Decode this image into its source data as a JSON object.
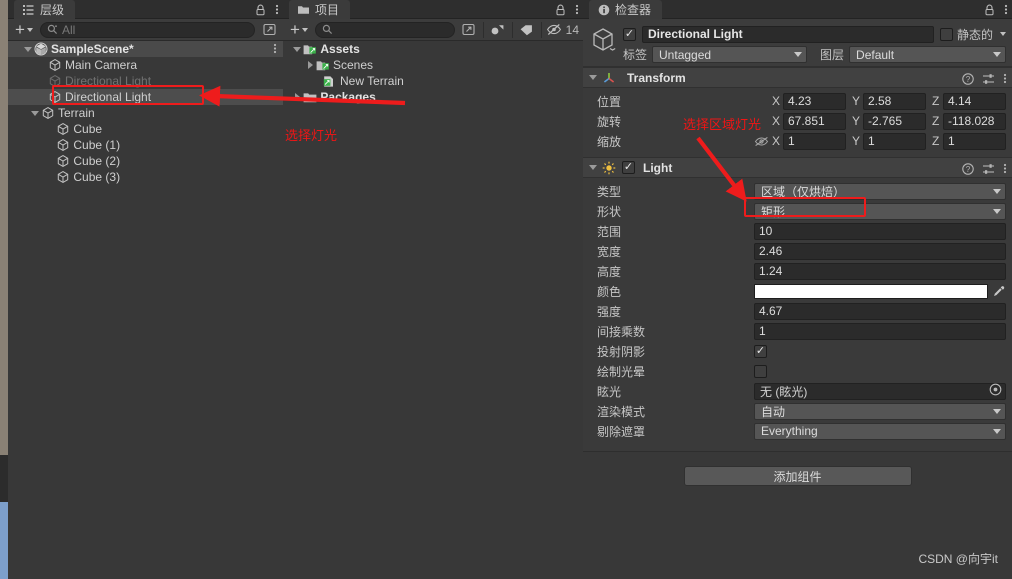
{
  "hierarchy": {
    "tab_label": "层级",
    "tab_icon": "hierarchy-icon",
    "search_placeholder": "All",
    "create_label": "+",
    "items": [
      {
        "label": "SampleScene*",
        "indent": 1,
        "icon": "unity-scene-icon",
        "foldout": "down",
        "bold": true,
        "state": "scene"
      },
      {
        "label": "Main Camera",
        "indent": 2,
        "icon": "gameobject-icon",
        "foldout": "none",
        "bold": false,
        "state": "normal"
      },
      {
        "label": "Directional Light",
        "indent": 2,
        "icon": "gameobject-icon",
        "foldout": "none",
        "bold": false,
        "state": "ghost"
      },
      {
        "label": "Directional Light",
        "indent": 2,
        "icon": "gameobject-icon",
        "foldout": "none",
        "bold": false,
        "state": "selected"
      },
      {
        "label": "Terrain",
        "indent": 1.5,
        "icon": "gameobject-icon",
        "foldout": "down",
        "bold": false,
        "state": "normal"
      },
      {
        "label": "Cube",
        "indent": 2.6,
        "icon": "gameobject-icon",
        "foldout": "none",
        "bold": false,
        "state": "normal"
      },
      {
        "label": "Cube (1)",
        "indent": 2.6,
        "icon": "gameobject-icon",
        "foldout": "none",
        "bold": false,
        "state": "normal"
      },
      {
        "label": "Cube (2)",
        "indent": 2.6,
        "icon": "gameobject-icon",
        "foldout": "none",
        "bold": false,
        "state": "normal"
      },
      {
        "label": "Cube (3)",
        "indent": 2.6,
        "icon": "gameobject-icon",
        "foldout": "none",
        "bold": false,
        "state": "normal"
      }
    ]
  },
  "project": {
    "tab_label": "项目",
    "tab_icon": "folder-icon",
    "search_placeholder": "",
    "create_label": "+",
    "hidden_count": "14",
    "items": [
      {
        "label": "Assets",
        "indent": 0.6,
        "icon": "assets-folder-icon",
        "foldout": "down",
        "bold": true
      },
      {
        "label": "Scenes",
        "indent": 1.5,
        "icon": "assets-folder-icon",
        "foldout": "right",
        "bold": false
      },
      {
        "label": "New Terrain",
        "indent": 2.0,
        "icon": "terrain-asset-icon",
        "foldout": "none",
        "bold": false
      },
      {
        "label": "Packages",
        "indent": 0.6,
        "icon": "folder-plain-icon",
        "foldout": "right",
        "bold": true
      }
    ]
  },
  "inspector": {
    "tab_label": "检查器",
    "tab_icon": "info-icon",
    "object_name": "Directional Light",
    "enabled": true,
    "static_label": "静态的",
    "static_checked": false,
    "tag_label": "标签",
    "tag_value": "Untagged",
    "layer_label": "图层",
    "layer_value": "Default",
    "transform": {
      "title": "Transform",
      "icon": "transform-axis-icon",
      "rows": [
        {
          "label": "位置",
          "x": "4.23",
          "y": "2.58",
          "z": "4.14"
        },
        {
          "label": "旋转",
          "x": "67.851",
          "y": "-2.765",
          "z": "-118.028"
        },
        {
          "label": "缩放",
          "x": "1",
          "y": "1",
          "z": "1",
          "link_icon": "constrain-proportions-off-icon"
        }
      ],
      "axis_labels": [
        "X",
        "Y",
        "Z"
      ]
    },
    "light": {
      "title": "Light",
      "icon": "light-bulb-icon",
      "enabled": true,
      "fields": [
        {
          "kind": "dropdown",
          "label": "类型",
          "value": "区域（仅烘焙）",
          "highlight": true
        },
        {
          "kind": "dropdown",
          "label": "形状",
          "value": "矩形",
          "highlight": false
        },
        {
          "kind": "text",
          "label": "范围",
          "value": "10"
        },
        {
          "kind": "text",
          "label": "宽度",
          "value": "2.46"
        },
        {
          "kind": "text",
          "label": "高度",
          "value": "1.24"
        },
        {
          "kind": "color",
          "label": "颜色",
          "value": "#ffffff"
        },
        {
          "kind": "text",
          "label": "强度",
          "value": "4.67"
        },
        {
          "kind": "text",
          "label": "间接乘数",
          "value": "1"
        },
        {
          "kind": "checkbox",
          "label": "投射阴影",
          "checked": true
        },
        {
          "kind": "checkbox",
          "label": "绘制光晕",
          "checked": false
        },
        {
          "kind": "object",
          "label": "眩光",
          "value": "无 (眩光)"
        },
        {
          "kind": "dropdown",
          "label": "渲染模式",
          "value": "自动",
          "highlight": false
        },
        {
          "kind": "dropdown",
          "label": "剔除遮罩",
          "value": "Everything",
          "highlight": false
        }
      ]
    },
    "add_component_label": "添加组件",
    "watermark": "CSDN @向宇it"
  },
  "annotations": {
    "accent_color": "#ee1c1c",
    "note_hierarchy": "选择灯光",
    "note_inspector": "选择区域灯光"
  }
}
